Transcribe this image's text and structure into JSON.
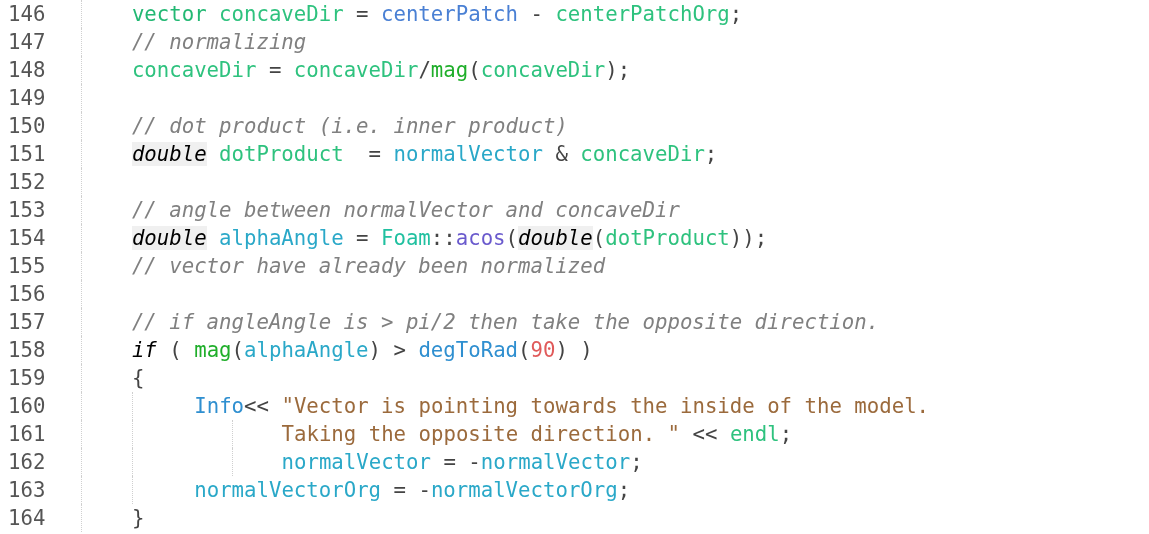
{
  "editor": {
    "lines": [
      {
        "number": "146",
        "tokens": [
          {
            "kind": "type",
            "text": "vector "
          },
          {
            "kind": "local",
            "text": "concaveDir"
          },
          {
            "kind": "plain",
            "text": " = "
          },
          {
            "kind": "field",
            "text": "centerPatch"
          },
          {
            "kind": "plain",
            "text": " - "
          },
          {
            "kind": "local",
            "text": "centerPatchOrg"
          },
          {
            "kind": "plain",
            "text": ";"
          }
        ]
      },
      {
        "number": "147",
        "tokens": [
          {
            "kind": "comment",
            "text": "// normalizing"
          }
        ]
      },
      {
        "number": "148",
        "tokens": [
          {
            "kind": "local",
            "text": "concaveDir"
          },
          {
            "kind": "plain",
            "text": " = "
          },
          {
            "kind": "local",
            "text": "concaveDir"
          },
          {
            "kind": "plain",
            "text": "/"
          },
          {
            "kind": "function",
            "text": "mag"
          },
          {
            "kind": "plain",
            "text": "("
          },
          {
            "kind": "local",
            "text": "concaveDir"
          },
          {
            "kind": "plain",
            "text": ");"
          }
        ]
      },
      {
        "number": "149"
      },
      {
        "number": "150",
        "tokens": [
          {
            "kind": "comment",
            "text": "// dot product (i.e. inner product)"
          }
        ]
      },
      {
        "number": "151",
        "tokens": [
          {
            "kind": "builtin",
            "text": "double"
          },
          {
            "kind": "local",
            "text": " dotProduct"
          },
          {
            "kind": "plain",
            "text": "  = "
          },
          {
            "kind": "param",
            "text": "normalVector"
          },
          {
            "kind": "plain",
            "text": " & "
          },
          {
            "kind": "local",
            "text": "concaveDir"
          },
          {
            "kind": "plain",
            "text": ";"
          }
        ]
      },
      {
        "number": "152"
      },
      {
        "number": "153",
        "tokens": [
          {
            "kind": "comment",
            "text": "// angle between normalVector and concaveDir"
          }
        ]
      },
      {
        "number": "154",
        "tokens": [
          {
            "kind": "builtin",
            "text": "double"
          },
          {
            "kind": "param",
            "text": " alphaAngle"
          },
          {
            "kind": "plain",
            "text": " = "
          },
          {
            "kind": "namespace",
            "text": "Foam"
          },
          {
            "kind": "plain",
            "text": "::"
          },
          {
            "kind": "method",
            "text": "acos"
          },
          {
            "kind": "plain",
            "text": "("
          },
          {
            "kind": "builtin",
            "text": "double"
          },
          {
            "kind": "plain",
            "text": "("
          },
          {
            "kind": "local",
            "text": "dotProduct"
          },
          {
            "kind": "plain",
            "text": "));"
          }
        ]
      },
      {
        "number": "155",
        "tokens": [
          {
            "kind": "comment",
            "text": "// vector have already been normalized"
          }
        ]
      },
      {
        "number": "156"
      },
      {
        "number": "157",
        "tokens": [
          {
            "kind": "comment",
            "text": "// if angleAngle is > pi/2 then take the opposite direction."
          }
        ]
      },
      {
        "number": "158",
        "tokens": [
          {
            "kind": "keyword",
            "text": "if"
          },
          {
            "kind": "plain",
            "text": " ( "
          },
          {
            "kind": "function",
            "text": "mag"
          },
          {
            "kind": "plain",
            "text": "("
          },
          {
            "kind": "param",
            "text": "alphaAngle"
          },
          {
            "kind": "plain",
            "text": ") > "
          },
          {
            "kind": "macro",
            "text": "degToRad"
          },
          {
            "kind": "plain",
            "text": "("
          },
          {
            "kind": "number",
            "text": "90"
          },
          {
            "kind": "plain",
            "text": ") )"
          }
        ]
      },
      {
        "number": "159",
        "tokens": [
          {
            "kind": "plain",
            "text": "{"
          }
        ],
        "children": [
          {
            "number": "160",
            "tokens": [
              {
                "kind": "macro",
                "text": "Info"
              },
              {
                "kind": "plain",
                "text": "<< "
              },
              {
                "kind": "string",
                "text": "\"Vector is pointing towards the inside of the model."
              }
            ],
            "children": [
              {
                "number": "161",
                "tokens": [
                  {
                    "kind": "string",
                    "text": "Taking the opposite direction. \""
                  },
                  {
                    "kind": "plain",
                    "text": " << "
                  },
                  {
                    "kind": "local",
                    "text": "endl"
                  },
                  {
                    "kind": "plain",
                    "text": ";"
                  }
                ]
              },
              {
                "number": "162",
                "tokens": [
                  {
                    "kind": "param",
                    "text": "normalVector"
                  },
                  {
                    "kind": "plain",
                    "text": " = -"
                  },
                  {
                    "kind": "param",
                    "text": "normalVector"
                  },
                  {
                    "kind": "plain",
                    "text": ";"
                  }
                ]
              }
            ]
          },
          {
            "number": "163",
            "tokens": [
              {
                "kind": "param",
                "text": "normalVectorOrg"
              },
              {
                "kind": "plain",
                "text": " = -"
              },
              {
                "kind": "param",
                "text": "normalVectorOrg"
              },
              {
                "kind": "plain",
                "text": ";"
              }
            ]
          }
        ]
      },
      {
        "number": "164",
        "tokens": [
          {
            "kind": "plain",
            "text": "}"
          }
        ]
      }
    ]
  }
}
